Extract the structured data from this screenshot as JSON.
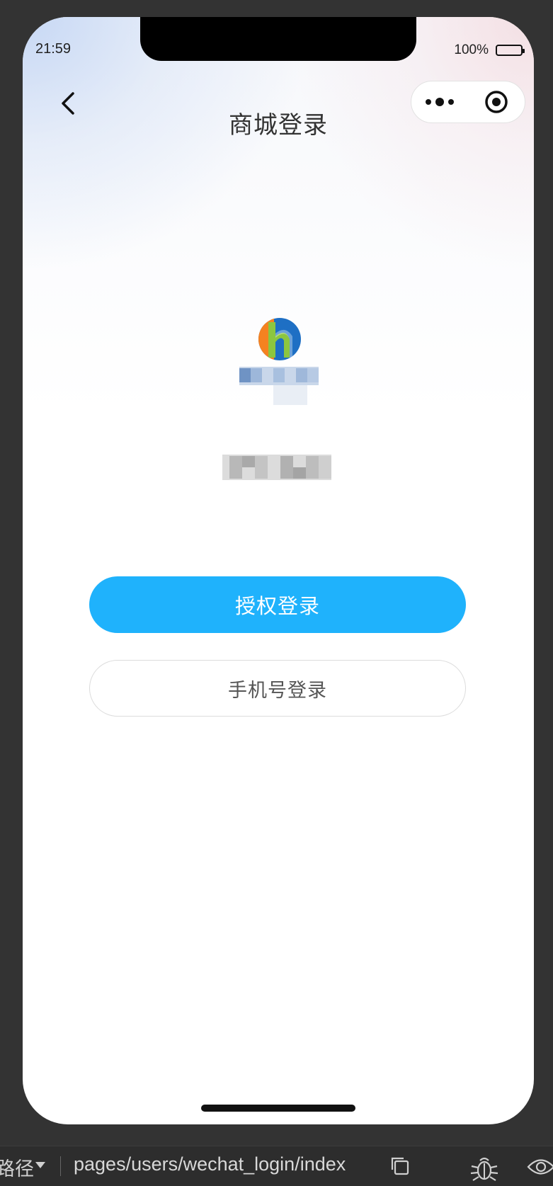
{
  "status_bar": {
    "time": "21:59",
    "battery_percent": "100%"
  },
  "nav_bar": {
    "title": "商城登录"
  },
  "buttons": {
    "authorize_login": "授权登录",
    "phone_login": "手机号登录"
  },
  "bottom_toolbar": {
    "path_label": "路径",
    "path_value": "pages/users/wechat_login/index"
  },
  "icons": {
    "back": "chevron-left-icon",
    "menu": "more-dots-icon",
    "close": "target-close-icon",
    "copy": "copy-icon",
    "debug": "bug-icon",
    "preview": "eye-icon"
  },
  "colors": {
    "primary_button": "#1fb2fc",
    "outline_border": "#dcdcdc",
    "logo_orange": "#f58220",
    "logo_blue": "#1e6fc4",
    "logo_green": "#8cc63f",
    "toolbar_bg": "#2d2d2d"
  }
}
